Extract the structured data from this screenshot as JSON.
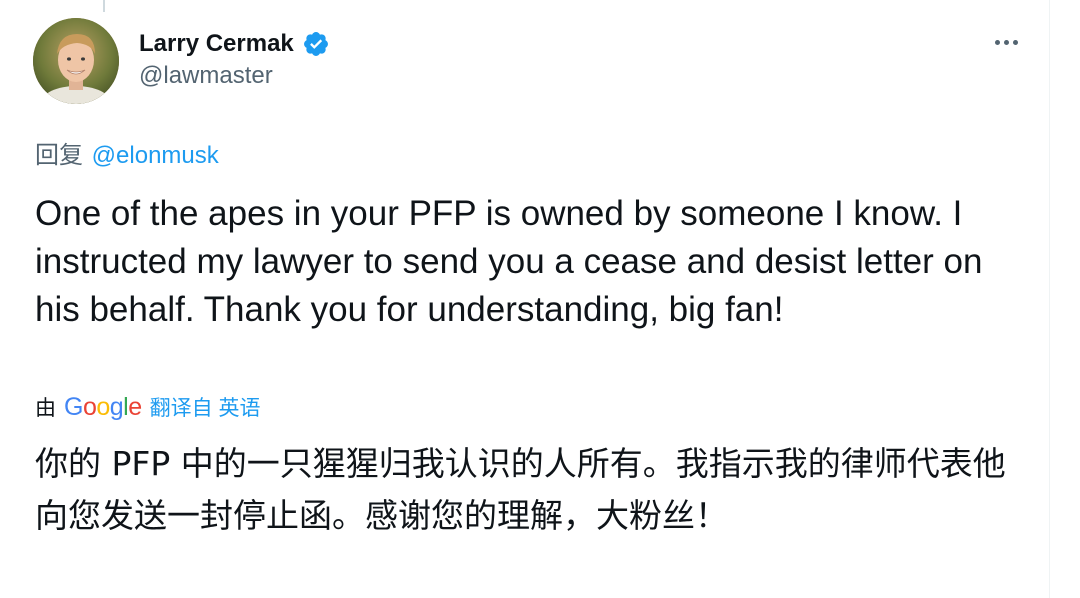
{
  "author": {
    "display_name": "Larry Cermak",
    "handle": "@lawmaster",
    "verified": true,
    "avatar_icon": "profile-photo"
  },
  "menu": {
    "more_icon": "more-horizontal-icon"
  },
  "reply": {
    "prefix": "回复",
    "mention": "@elonmusk"
  },
  "tweet": {
    "text": "One of the apes in your PFP is owned by someone I know. I instructed my lawyer to send you a cease and desist letter on his behalf. Thank you for understanding, big fan!"
  },
  "translation": {
    "prefix": "由",
    "provider_letters": [
      "G",
      "o",
      "o",
      "g",
      "l",
      "e"
    ],
    "link_text": "翻译自 英语",
    "text": "你的 PFP 中的一只猩猩归我认识的人所有。我指示我的律师代表他向您发送一封停止函。感谢您的理解，大粉丝！"
  },
  "colors": {
    "accent": "#1d9bf0",
    "secondary_text": "#536471",
    "primary_text": "#0f1419",
    "google": [
      "#4285f4",
      "#ea4335",
      "#fbbc05",
      "#4285f4",
      "#34a853",
      "#ea4335"
    ]
  }
}
